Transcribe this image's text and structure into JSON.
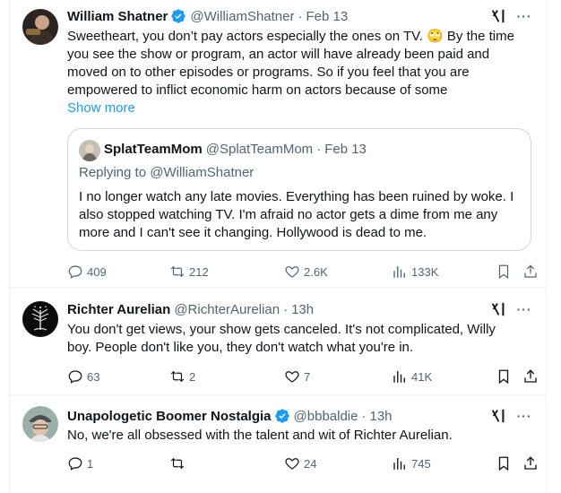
{
  "tweets": [
    {
      "author": "William Shatner",
      "handle": "@WilliamShatner",
      "time": "Feb 13",
      "verified": true,
      "lines": [
        "Sweetheart, you don’t pay actors especially the ones on TV. 🙄 By the time",
        "you see the show or program, an actor will have already been paid and",
        "moved on to other episodes or programs.  So if you feel that you are",
        "empowered to inflict economic harm on actors because of some"
      ],
      "show_more": "Show more",
      "quote": {
        "author": "SplatTeamMom",
        "handle": "@SplatTeamMom",
        "time": "Feb 13",
        "replying": "Replying to @WilliamShatner",
        "lines": [
          "I no longer watch any late movies. Everything has been ruined by woke. I",
          "also stopped watching TV. I'm afraid no actor gets a dime from me any",
          "more and I can't see it changing. Hollywood is dead to me."
        ]
      },
      "replies": "409",
      "retweets": "212",
      "likes": "2.6K",
      "views": "133K"
    },
    {
      "author": "Richter Aurelian",
      "handle": "@RichterAurelian",
      "time": "13h",
      "verified": false,
      "lines": [
        "You don't get views, your show gets canceled. It's not complicated, Willy",
        "boy. People don't like you, they don't watch what you're in."
      ],
      "replies": "63",
      "retweets": "2",
      "likes": "7",
      "views": "41K"
    },
    {
      "author": "Unapologetic Boomer Nostalgia",
      "handle": "@bbbaldie",
      "time": "13h",
      "verified": true,
      "lines": [
        "No, we're all obsessed with the talent and wit of Richter Aurelian."
      ],
      "replies": "1",
      "retweets": "",
      "likes": "24",
      "views": "745"
    }
  ],
  "colors": {
    "text": "#0f1419",
    "secondary": "#536471",
    "link": "#1d9bf0",
    "verified": "#1d9bf0",
    "border": "#cfd9de"
  }
}
